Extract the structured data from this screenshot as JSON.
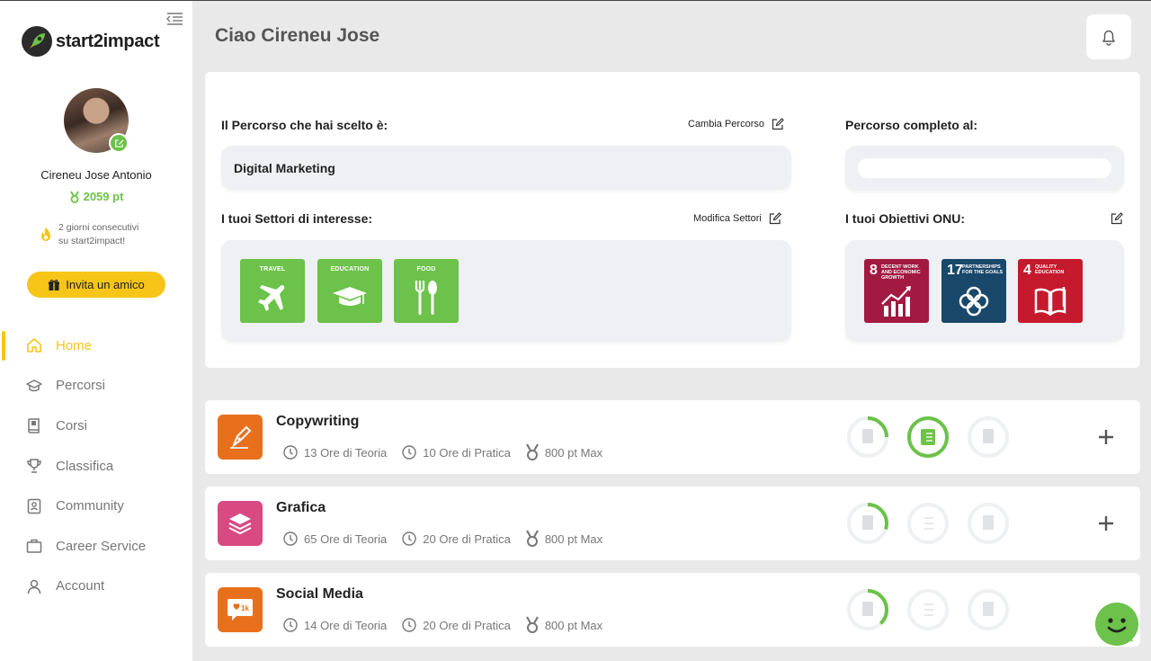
{
  "app": {
    "logo_text": "start2impact"
  },
  "user": {
    "name": "Cireneu Jose Antonio",
    "points": "2059 pt",
    "streak_line1": "2 giorni consecutivi",
    "streak_line2": "su start2impact!"
  },
  "invite": {
    "label": "Invita un amico"
  },
  "nav": [
    {
      "label": "Home",
      "icon": "home-icon",
      "active": true
    },
    {
      "label": "Percorsi",
      "icon": "graduation-cap-icon"
    },
    {
      "label": "Corsi",
      "icon": "book-icon"
    },
    {
      "label": "Classifica",
      "icon": "trophy-icon"
    },
    {
      "label": "Community",
      "icon": "community-badge-icon"
    },
    {
      "label": "Career Service",
      "icon": "briefcase-icon"
    },
    {
      "label": "Account",
      "icon": "user-icon"
    }
  ],
  "header": {
    "greeting": "Ciao Cireneu Jose"
  },
  "profile": {
    "path_label": "Il Percorso che hai scelto è:",
    "path_action": "Cambia Percorso",
    "path_value": "Digital Marketing",
    "complete_label": "Percorso completo al:",
    "complete_progress": 0,
    "sectors_label": "I tuoi Settori di interesse:",
    "sectors_action": "Modifica Settori",
    "sectors": [
      {
        "label": "TRAVEL",
        "icon": "airplane-icon"
      },
      {
        "label": "EDUCATION",
        "icon": "mortarboard-icon"
      },
      {
        "label": "FOOD",
        "icon": "fork-spoon-icon"
      }
    ],
    "goals_label": "I tuoi Obiettivi ONU:",
    "goals": [
      {
        "num": "8",
        "text": "DECENT WORK AND ECONOMIC GROWTH",
        "color": "#a21942"
      },
      {
        "num": "17",
        "text": "PARTNERSHIPS FOR THE GOALS",
        "color": "#19486a"
      },
      {
        "num": "4",
        "text": "QUALITY EDUCATION",
        "color": "#c5192d"
      }
    ]
  },
  "courses": [
    {
      "title": "Copywriting",
      "theory": "13 Ore di Teoria",
      "practice": "10 Ore di Pratica",
      "points": "800 pt Max",
      "color": "#e8701d",
      "icon": "pen-nib-icon",
      "rings": [
        0.25,
        1,
        0
      ]
    },
    {
      "title": "Grafica",
      "theory": "65 Ore di Teoria",
      "practice": "20 Ore di Pratica",
      "points": "800 pt Max",
      "color": "#d94a82",
      "icon": "layers-icon",
      "rings": [
        0.3,
        0,
        0
      ]
    },
    {
      "title": "Social Media",
      "theory": "14 Ore di Teoria",
      "practice": "20 Ore di Pratica",
      "points": "800 pt Max",
      "color": "#e8701d",
      "icon": "like-bubble-icon",
      "rings": [
        0.38,
        0,
        0
      ]
    }
  ],
  "colors": {
    "accent_yellow": "#f6c518",
    "green": "#6cc24a"
  }
}
